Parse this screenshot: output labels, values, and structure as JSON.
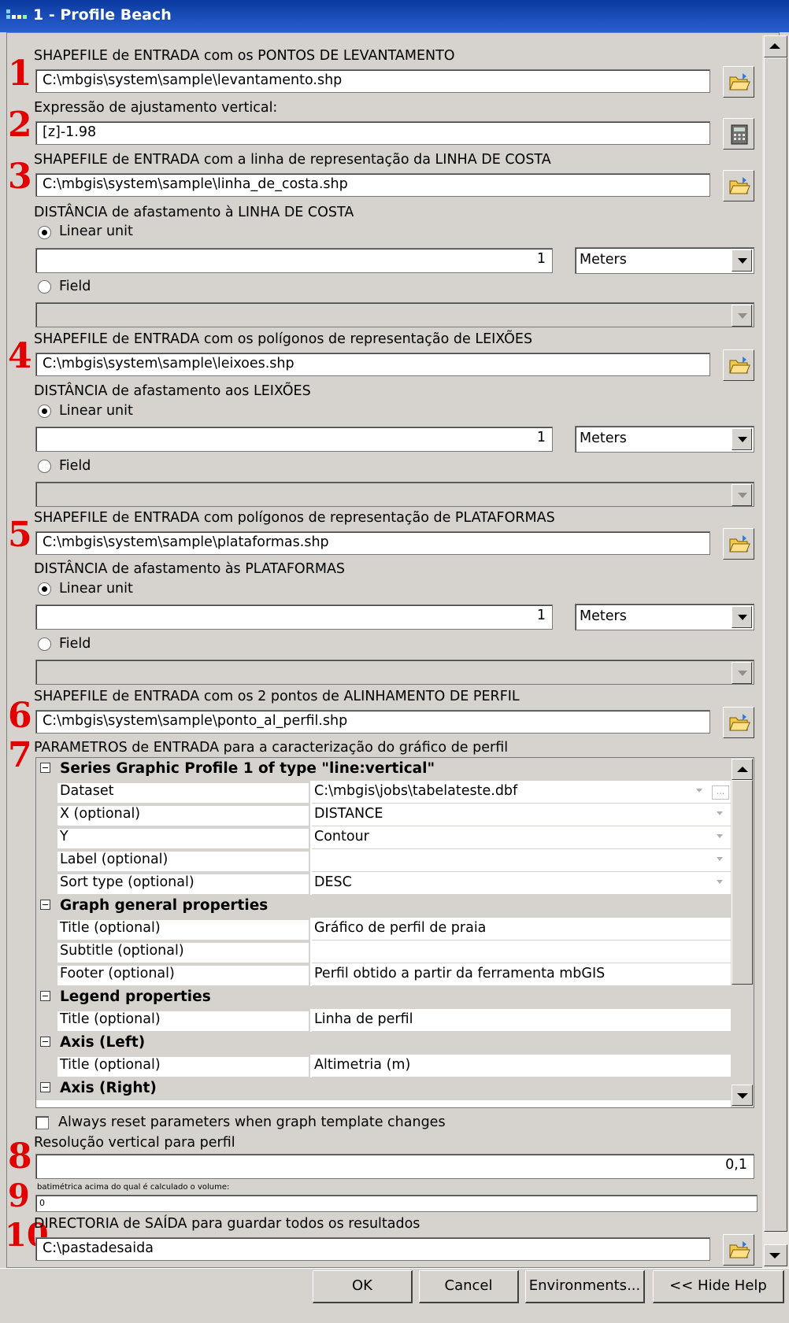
{
  "window": {
    "title": "1 - Profile Beach"
  },
  "markers": [
    "1",
    "2",
    "3",
    "4",
    "5",
    "6",
    "7",
    "8",
    "9",
    "10"
  ],
  "sections": {
    "s1": {
      "label": "SHAPEFILE de ENTRADA com os PONTOS DE LEVANTAMENTO",
      "value": "C:\\mbgis\\system\\sample\\levantamento.shp"
    },
    "s2": {
      "label": "Expressão de ajustamento vertical:",
      "value": "[z]-1.98"
    },
    "s3": {
      "label": "SHAPEFILE de ENTRADA com a linha de representação da LINHA DE COSTA",
      "value": "C:\\mbgis\\system\\sample\\linha_de_costa.shp"
    },
    "s3d": {
      "label": "DISTÂNCIA de afastamento à LINHA DE COSTA",
      "linear_label": "Linear unit",
      "value": "1",
      "unit": "Meters",
      "field_label": "Field"
    },
    "s4": {
      "label": "SHAPEFILE de ENTRADA com os polígonos de representação de LEIXÕES",
      "value": "C:\\mbgis\\system\\sample\\leixoes.shp"
    },
    "s4d": {
      "label": "DISTÂNCIA de afastamento aos LEIXÕES",
      "linear_label": "Linear unit",
      "value": "1",
      "unit": "Meters",
      "field_label": "Field"
    },
    "s5": {
      "label": "SHAPEFILE de ENTRADA com polígonos de representação de PLATAFORMAS",
      "value": "C:\\mbgis\\system\\sample\\plataformas.shp"
    },
    "s5d": {
      "label": "DISTÂNCIA de afastamento às PLATAFORMAS",
      "linear_label": "Linear unit",
      "value": "1",
      "unit": "Meters",
      "field_label": "Field"
    },
    "s6": {
      "label": "SHAPEFILE de ENTRADA com os 2 pontos de ALINHAMENTO DE PERFIL",
      "value": "C:\\mbgis\\system\\sample\\ponto_al_perfil.shp"
    },
    "s7": {
      "label": "PARAMETROS de ENTRADA para a caracterização do gráfico de perfil"
    },
    "s8": {
      "label": "Resolução vertical para perfil",
      "value": "0,1"
    },
    "s9": {
      "label": "batimétrica acima do qual é calculado o volume:",
      "value": "0"
    },
    "s10": {
      "label": "DIRECTORIA de SAÍDA para guardar todos os resultados",
      "value": "C:\\pastadesaida"
    }
  },
  "grid": {
    "cat1": "Series Graphic Profile 1 of type \"line:vertical\"",
    "rows1": [
      {
        "name": "Dataset",
        "value": "C:\\mbgis\\jobs\\tabelateste.dbf"
      },
      {
        "name": "X (optional)",
        "value": "DISTANCE"
      },
      {
        "name": "Y",
        "value": "Contour"
      },
      {
        "name": "Label (optional)",
        "value": ""
      },
      {
        "name": "Sort type (optional)",
        "value": "DESC"
      }
    ],
    "cat2": "Graph general properties",
    "rows2": [
      {
        "name": "Title (optional)",
        "value": "Gráfico de perfil de praia"
      },
      {
        "name": "Subtitle (optional)",
        "value": ""
      },
      {
        "name": "Footer (optional)",
        "value": "Perfil obtido a partir da ferramenta mbGIS"
      }
    ],
    "cat3": "Legend properties",
    "rows3": [
      {
        "name": "Title (optional)",
        "value": "Linha de perfil"
      }
    ],
    "cat4": "Axis (Left)",
    "rows4": [
      {
        "name": "Title (optional)",
        "value": "Altimetria (m)"
      }
    ],
    "cat5": "Axis (Right)"
  },
  "checkbox_label": "Always reset parameters when graph template changes",
  "buttons": {
    "ok": "OK",
    "cancel": "Cancel",
    "environments": "Environments...",
    "hide_help": "<< Hide Help"
  },
  "colors": {
    "marker": "#e00000",
    "title_bar": "#0a3aa0",
    "dialog_bg": "#d6d3ce"
  }
}
